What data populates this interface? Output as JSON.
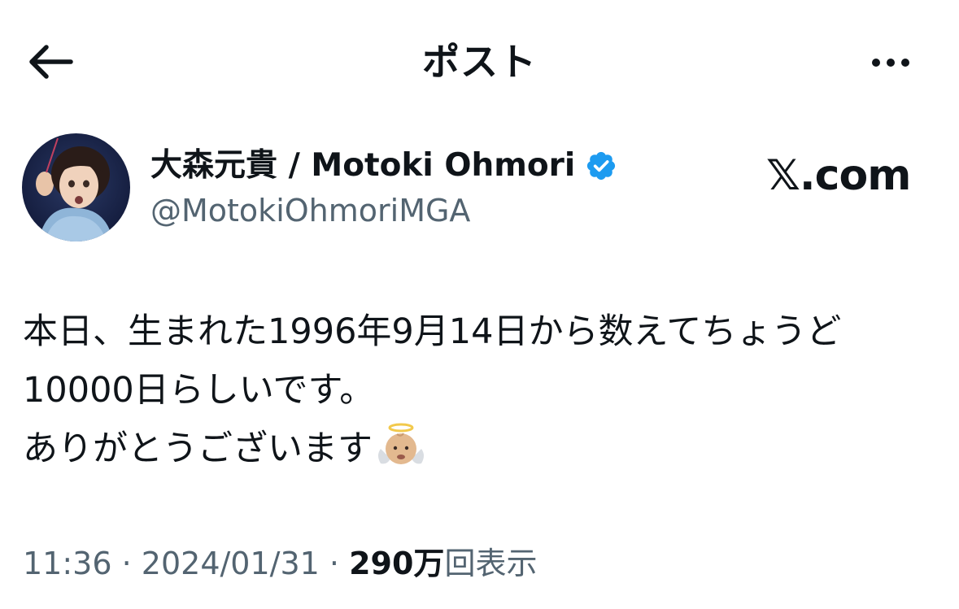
{
  "header": {
    "title": "ポスト",
    "back_icon": "arrow-left-icon",
    "more_icon": "more-horizontal-icon"
  },
  "author": {
    "name": "大森元貴 / Motoki Ohmori",
    "handle": "@MotokiOhmoriMGA",
    "verified": true,
    "verified_color": "#1d9bf0"
  },
  "watermark": "𝕏.com",
  "post": {
    "lines": [
      "本日、生まれた1996年9月14日から数えてちょうど",
      "10000日らしいです。",
      "ありがとうございます"
    ],
    "emoji": "baby-angel-emoji"
  },
  "meta": {
    "time": "11:36",
    "separator": "·",
    "date": "2024/01/31",
    "views_count": "290万",
    "views_label": "回表示"
  },
  "colors": {
    "text_primary": "#0f1419",
    "text_secondary": "#536471",
    "accent": "#1d9bf0"
  }
}
